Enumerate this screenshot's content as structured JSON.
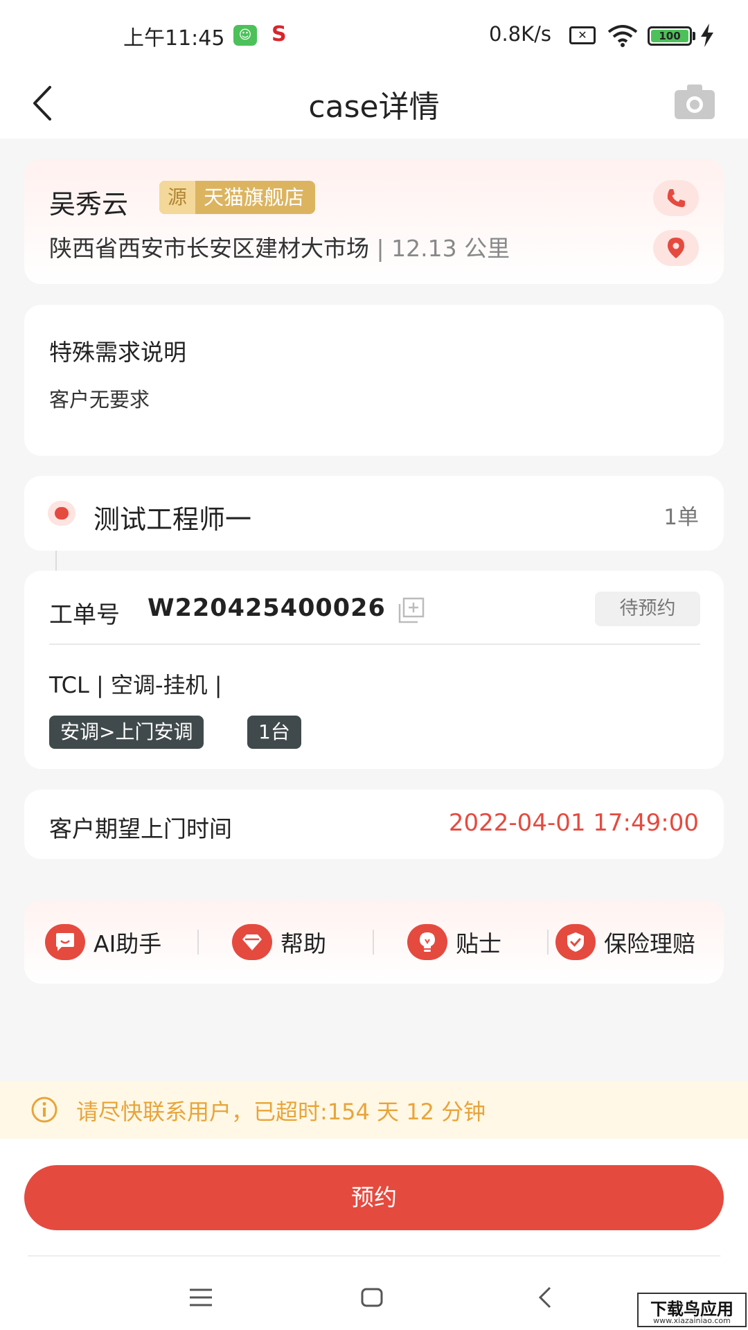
{
  "status_bar": {
    "time": "上午11:45",
    "app_badge_red": "S",
    "net_speed": "0.8K/s",
    "battery": "100"
  },
  "header": {
    "title": "case详情"
  },
  "customer": {
    "name": "吴秀云",
    "source_prefix": "源",
    "source_name": "天猫旗舰店",
    "address": "陕西省西安市长安区建材大市场",
    "distance": "12.13 公里"
  },
  "special_requirement": {
    "title": "特殊需求说明",
    "text": "客户无要求"
  },
  "engineer": {
    "name": "测试工程师一",
    "count": "1单"
  },
  "order": {
    "label": "工单号",
    "number": "W220425400026",
    "status": "待预约",
    "product": "TCL | 空调-挂机 |",
    "service": "安调>上门安调",
    "quantity": "1台"
  },
  "expected_time": {
    "label": "客户期望上门时间",
    "value": "2022-04-01 17:49:00"
  },
  "tools": [
    {
      "label": "AI助手",
      "icon": "ai-assistant-icon"
    },
    {
      "label": "帮助",
      "icon": "help-gem-icon"
    },
    {
      "label": "贴士",
      "icon": "tips-bulb-icon"
    },
    {
      "label": "保险理赔",
      "icon": "insurance-shield-icon"
    }
  ],
  "warning": {
    "text": "请尽快联系用户，已超时:154 天 12 分钟"
  },
  "actions": {
    "book_label": "预约"
  },
  "watermark": {
    "main": "下载鸟应用",
    "sub": "www.xiazainiao.com"
  },
  "colors": {
    "accent": "#e54a3f",
    "warning": "#e8a43a",
    "source_tag": "#dcb460"
  }
}
